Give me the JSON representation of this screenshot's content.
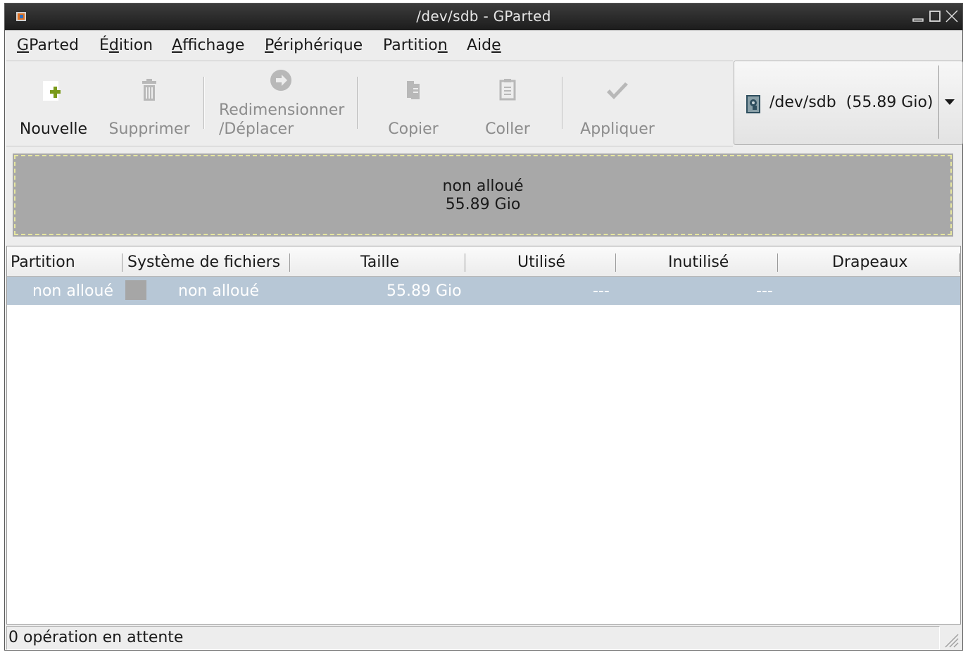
{
  "window": {
    "title": "/dev/sdb - GParted"
  },
  "menubar": {
    "items": [
      {
        "label": "GParted",
        "mnemonic_index": 0
      },
      {
        "label": "Édition",
        "mnemonic_index": 1
      },
      {
        "label": "Affichage",
        "mnemonic_index": 0
      },
      {
        "label": "Périphérique",
        "mnemonic_index": 0
      },
      {
        "label": "Partition",
        "mnemonic_index": 8
      },
      {
        "label": "Aide",
        "mnemonic_index": 3
      }
    ]
  },
  "toolbar": {
    "new_label": "Nouvelle",
    "delete_label": "Supprimer",
    "resize_label_1": "Redimensionner",
    "resize_label_2": "/Déplacer",
    "copy_label": "Copier",
    "paste_label": "Coller",
    "apply_label": "Appliquer"
  },
  "device_selector": {
    "device": "/dev/sdb",
    "size": "(55.89 Gio)"
  },
  "disk_map": {
    "label": "non alloué",
    "size": "55.89 Gio"
  },
  "table": {
    "columns": [
      "Partition",
      "Système de fichiers",
      "Taille",
      "Utilisé",
      "Inutilisé",
      "Drapeaux"
    ],
    "rows": [
      {
        "partition": "non alloué",
        "filesystem": "non alloué",
        "size": "55.89 Gio",
        "used": "---",
        "unused": "---",
        "flags": ""
      }
    ]
  },
  "statusbar": {
    "text": "0 opération en attente"
  },
  "colors": {
    "unallocated": "#a8a8a8",
    "selection": "#b7c7d6",
    "new_icon": "#7a9a1a"
  }
}
